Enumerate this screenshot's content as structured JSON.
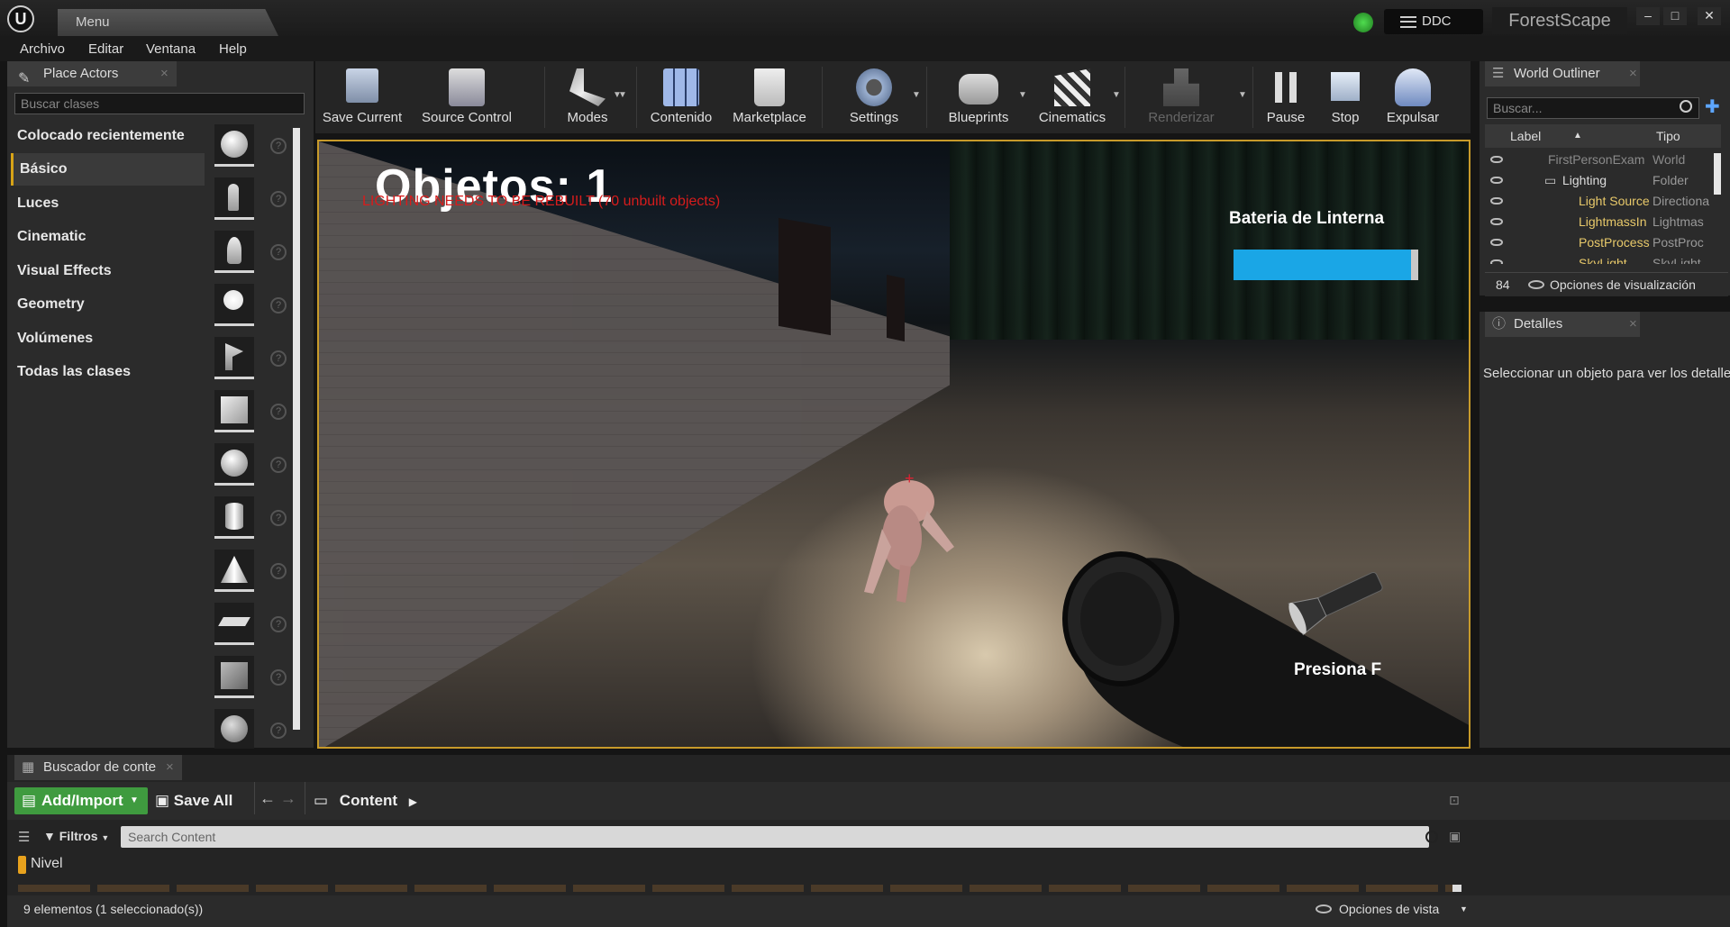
{
  "titlebar": {
    "menu_tab": "Menu",
    "ddc": "DDC",
    "project": "ForestScape",
    "minimize": "–",
    "maximize": "□",
    "close": "✕"
  },
  "menubar": [
    "Archivo",
    "Editar",
    "Ventana",
    "Help"
  ],
  "place_actors": {
    "tab_label": "Place Actors",
    "search_placeholder": "Buscar clases",
    "categories": [
      "Colocado recientemente",
      "Básico",
      "Luces",
      "Cinematic",
      "Visual Effects",
      "Geometry",
      "Volúmenes",
      "Todas las clases"
    ],
    "selected_category": "Básico",
    "actor_icons": [
      "sphere-icon",
      "character-icon",
      "pawn-icon",
      "point-light-icon",
      "player-start-icon",
      "cube-icon",
      "sphere-icon",
      "cylinder-icon",
      "cone-icon",
      "plane-icon",
      "box-trigger-icon",
      "sphere-trigger-icon"
    ]
  },
  "toolbar": {
    "buttons": [
      {
        "label": "Save Current",
        "icon": "save-icon"
      },
      {
        "label": "Source Control",
        "icon": "source-control-icon"
      },
      {
        "label": "Modes",
        "icon": "modes-icon"
      },
      {
        "label": "Contenido",
        "icon": "content-icon"
      },
      {
        "label": "Marketplace",
        "icon": "marketplace-icon"
      },
      {
        "label": "Settings",
        "icon": "settings-icon"
      },
      {
        "label": "Blueprints",
        "icon": "blueprints-icon"
      },
      {
        "label": "Cinematics",
        "icon": "cinematics-icon"
      },
      {
        "label": "Renderizar",
        "icon": "build-icon"
      },
      {
        "label": "Pause",
        "icon": "pause-icon"
      },
      {
        "label": "Stop",
        "icon": "stop-icon"
      },
      {
        "label": "Expulsar",
        "icon": "eject-icon"
      }
    ]
  },
  "viewport": {
    "score": "Objetos: 1",
    "lighting_warning": "LIGHTING NEEDS TO BE REBUILT (70 unbuilt objects)",
    "battery_label": "Bateria de Linterna",
    "battery_level": 0.96,
    "battery_color": "#1aa6e6",
    "press_hint": "Presiona F"
  },
  "outliner": {
    "tab_label": "World Outliner",
    "search_placeholder": "Buscar...",
    "col_label": "Label",
    "col_type": "Tipo",
    "rows": [
      {
        "label": "FirstPersonExam",
        "type": "World"
      },
      {
        "label": "Lighting",
        "type": "Folder"
      },
      {
        "label": "Light Source",
        "type": "Directiona"
      },
      {
        "label": "LightmassIn",
        "type": "Lightmas"
      },
      {
        "label": "PostProcess",
        "type": "PostProc"
      },
      {
        "label": "SkyLight",
        "type": "SkyLight"
      }
    ],
    "count": "84",
    "view_options": "Opciones de visualización"
  },
  "details": {
    "tab_label": "Detalles",
    "message": "Seleccionar un objeto para ver los detalles"
  },
  "content_browser": {
    "tab_label": "Buscador de conte",
    "add_import": "Add/Import",
    "save_all": "Save All",
    "path": "Content",
    "filters": "Filtros",
    "search_placeholder": "Search Content",
    "nivel": "Nivel",
    "status": "9 elementos (1 seleccionado(s))",
    "view_options": "Opciones de vista"
  },
  "colors": {
    "accent": "#c79a2a",
    "add_button": "#3f9b3f",
    "warning": "#d61c1c"
  }
}
